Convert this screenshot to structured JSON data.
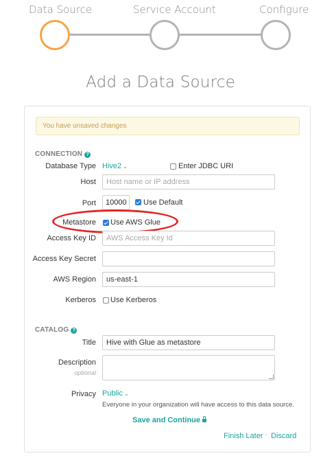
{
  "stepper": {
    "steps": [
      "Data Source",
      "Service Account",
      "Configure"
    ]
  },
  "page_title": "Add a Data Source",
  "alert": "You have unsaved changes",
  "connection": {
    "header": "CONNECTION",
    "database_type_label": "Database Type",
    "database_type_value": "Hive2",
    "jdbc_label": "Enter JDBC URI",
    "jdbc_checked": false,
    "host_label": "Host",
    "host_placeholder": "Host name or IP address",
    "port_label": "Port",
    "port_value": "10000",
    "use_default_label": "Use Default",
    "use_default_checked": true,
    "metastore_label": "Metastore",
    "use_aws_glue_label": "Use AWS Glue",
    "use_aws_glue_checked": true,
    "access_key_id_label": "Access Key ID",
    "access_key_id_placeholder": "AWS Access Key Id",
    "access_key_secret_label": "Access Key Secret",
    "access_key_secret_value": "",
    "aws_region_label": "AWS Region",
    "aws_region_value": "us-east-1",
    "kerberos_label": "Kerberos",
    "use_kerberos_label": "Use Kerberos",
    "use_kerberos_checked": false
  },
  "catalog": {
    "header": "CATALOG",
    "title_label": "Title",
    "title_value": "Hive with Glue as metastore",
    "description_label": "Description",
    "description_sublabel": "optional",
    "privacy_label": "Privacy",
    "privacy_value": "Public",
    "privacy_hint": "Everyone in your organization will have access to this data source."
  },
  "actions": {
    "save_continue": "Save and Continue",
    "finish_later": "Finish Later",
    "separator": "·",
    "discard": "Discard"
  },
  "colors": {
    "accent": "#1ba39c",
    "active_step": "#f5a346",
    "inactive_step": "#b3b3b3",
    "highlight": "#e32525",
    "checkbox": "#2a7ae2"
  }
}
